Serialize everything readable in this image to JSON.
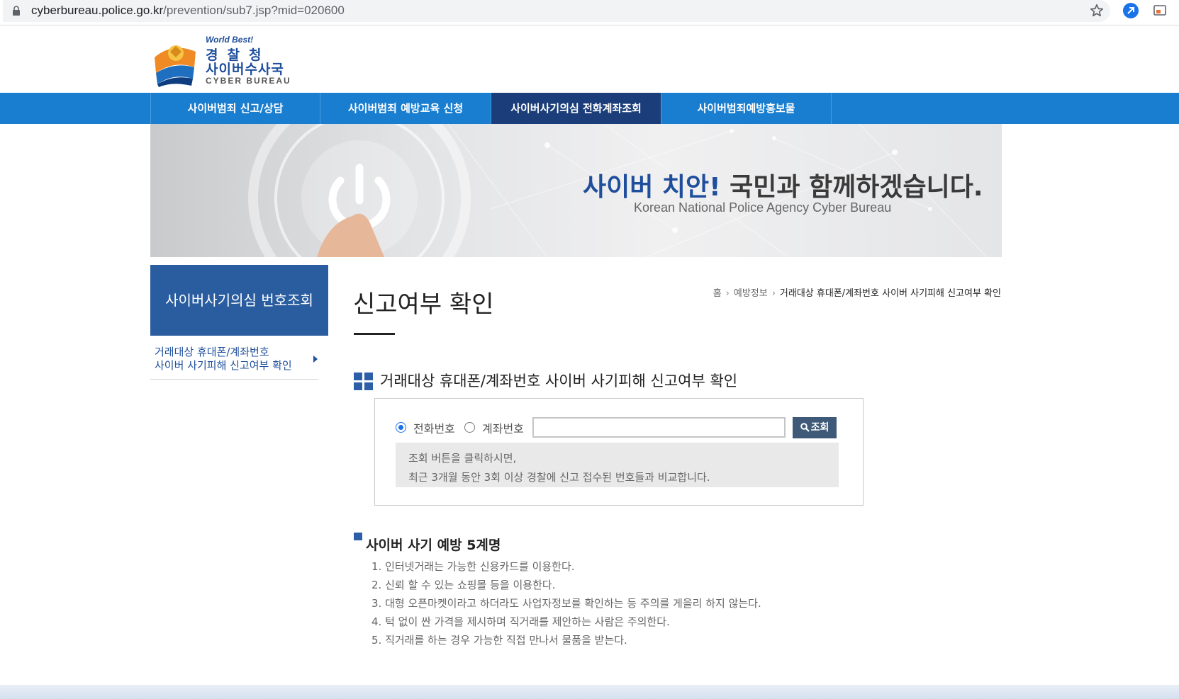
{
  "browser": {
    "url_host": "cyberbureau.police.go.kr",
    "url_path": "/prevention/sub7.jsp?mid=020600"
  },
  "logo": {
    "world_best": "World Best!",
    "line1": "경찰청",
    "line2": "사이버수사국",
    "line3": "CYBER BUREAU"
  },
  "nav": {
    "items": [
      {
        "label": "사이버범죄 신고/상담"
      },
      {
        "label": "사이버범죄 예방교육 신청"
      },
      {
        "label": "사이버사기의심 전화계좌조회"
      },
      {
        "label": "사이버범죄예방홍보물"
      }
    ],
    "active_index": 2
  },
  "banner": {
    "title_highlight": "사이버 치안!",
    "title_rest": " 국민과 함께하겠습니다.",
    "subtitle": "Korean National Police Agency Cyber Bureau"
  },
  "sidebar": {
    "heading": "사이버사기의심 번호조회",
    "link_line1": "거래대상 휴대폰/계좌번호",
    "link_line2": "사이버 사기피해 신고여부 확인"
  },
  "page": {
    "title": "신고여부 확인",
    "breadcrumb": {
      "home": "홈",
      "level1": "예방정보",
      "current": "거래대상 휴대폰/계좌번호 사이버 사기피해 신고여부 확인"
    }
  },
  "search": {
    "section_title": "거래대상 휴대폰/계좌번호 사이버 사기피해 신고여부 확인",
    "radio_phone": "전화번호",
    "radio_account": "계좌번호",
    "selected": "전화번호",
    "input_value": "",
    "button_label": "조회",
    "notice_line1": "조회 버튼을 클릭하시면,",
    "notice_line2": "최근 3개월 동안 3회 이상 경찰에 신고 접수된 번호들과 비교합니다."
  },
  "tips": {
    "title": "사이버 사기 예방 5계명",
    "items": [
      "1. 인터넷거래는 가능한 신용카드를 이용한다.",
      "2. 신뢰 할 수 있는 쇼핑몰 등을 이용한다.",
      "3. 대형 오픈마켓이라고 하더라도 사업자정보를 확인하는 등 주의를 게을리 하지 않는다.",
      "4. 턱 없이 싼 가격을 제시하며 직거래를 제안하는 사람은 주의한다.",
      "5. 직거래를 하는 경우 가능한 직접 만나서 물품을 받는다."
    ]
  },
  "icons": {
    "lock": "lock-icon",
    "star": "bookmark-star-icon",
    "extension": "extension-icon",
    "cast": "cast-icon",
    "search": "search-icon",
    "power": "power-icon"
  },
  "colors": {
    "nav_bg": "#1a7ed0",
    "nav_active": "#1b3e7a",
    "sidebar_head": "#2a5d9f",
    "brand_blue": "#1f4e9c",
    "search_button": "#3f5a78"
  }
}
